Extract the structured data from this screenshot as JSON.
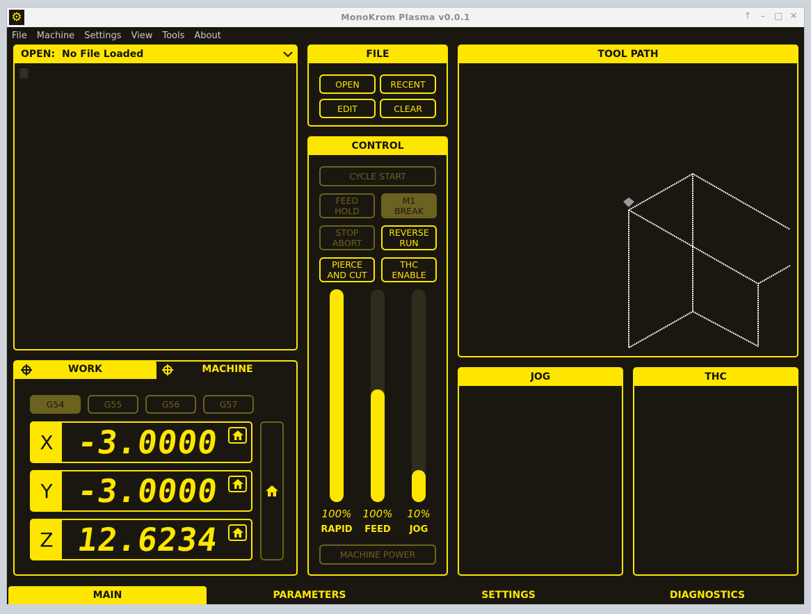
{
  "window": {
    "title": "MonoKrom Plasma v0.0.1"
  },
  "menu": [
    "File",
    "Machine",
    "Settings",
    "View",
    "Tools",
    "About"
  ],
  "gcode": {
    "open_label": "OPEN:",
    "file_name": "No File Loaded",
    "line_number": "1"
  },
  "file_panel": {
    "title": "FILE",
    "open": "OPEN",
    "recent": "RECENT",
    "edit": "EDIT",
    "clear": "CLEAR"
  },
  "control": {
    "title": "CONTROL",
    "cycle_start": "CYCLE START",
    "feed_hold": "FEED\nHOLD",
    "m1_break": "M1\nBREAK",
    "stop_abort": "STOP\nABORT",
    "reverse_run": "REVERSE\nRUN",
    "pierce_cut": "PIERCE\nAND CUT",
    "thc_enable": "THC\nENABLE",
    "machine_power": "MACHINE POWER",
    "sliders": [
      {
        "label": "RAPID",
        "value": "100%",
        "fraction": 1.0
      },
      {
        "label": "FEED",
        "value": "100%",
        "fraction": 0.53
      },
      {
        "label": "JOG",
        "value": "10%",
        "fraction": 0.15
      }
    ]
  },
  "toolpath": {
    "title": "TOOL PATH"
  },
  "dro": {
    "tab_work": "WORK",
    "tab_machine": "MACHINE",
    "offsets": [
      "G54",
      "G55",
      "G56",
      "G57"
    ],
    "x_label": "X",
    "x_value": "-3.0000",
    "y_label": "Y",
    "y_value": "-3.0000",
    "z_label": "Z",
    "z_value": "12.6234"
  },
  "jog": {
    "title": "JOG"
  },
  "thc": {
    "title": "THC"
  },
  "tabs": [
    "MAIN",
    "PARAMETERS",
    "SETTINGS",
    "DIAGNOSTICS"
  ],
  "colors": {
    "accent": "#ffe600",
    "background": "#1a1710",
    "dim": "#6b6220"
  }
}
